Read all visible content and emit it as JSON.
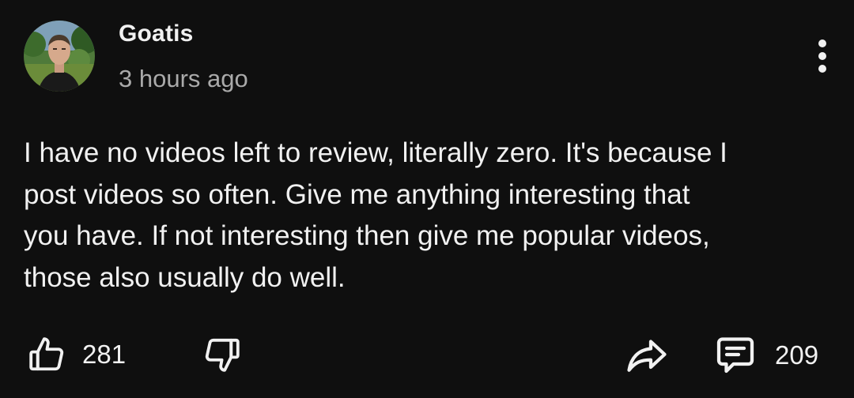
{
  "post": {
    "author": "Goatis",
    "timestamp": "3 hours ago",
    "body_lines": [
      "I have no videos left to review, literally zero. It's because I",
      "post videos so often. Give me anything interesting that",
      "you have. If not interesting then give me popular videos,",
      "those also usually do well."
    ]
  },
  "actions": {
    "like_count": "281",
    "comment_count": "209"
  },
  "icons": {
    "like": "thumbs-up-icon",
    "dislike": "thumbs-down-icon",
    "share": "share-arrow-icon",
    "comments": "comment-icon",
    "more": "more-vertical-icon"
  },
  "colors": {
    "background": "#0f0f0f",
    "text_primary": "#f1f1f1",
    "text_secondary": "#aaaaaa"
  }
}
